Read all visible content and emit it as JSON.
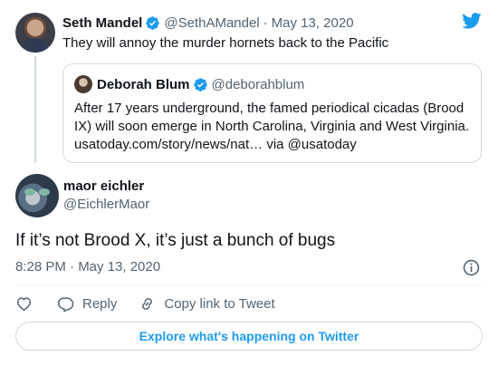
{
  "parent_tweet": {
    "author_name": "Seth Mandel",
    "handle": "@SethAMandel",
    "separator": "·",
    "date": "May 13, 2020",
    "text": "They will annoy the murder hornets back to the Pacific"
  },
  "quoted_tweet": {
    "author_name": "Deborah Blum",
    "handle": "@deborahblum",
    "text_lines": [
      "After 17 years underground, the famed periodical cicadas (Brood",
      "IX) will soon emerge in North Carolina, Virginia and West Virginia.",
      "usatoday.com/story/news/nat… via @usatoday"
    ]
  },
  "main_tweet": {
    "author_name": "maor eichler",
    "handle": "@EichlerMaor",
    "text": "If it’s not Brood X, it’s just a bunch of bugs",
    "timestamp": "8:28 PM · May 13, 2020"
  },
  "actions": {
    "reply_label": "Reply",
    "copy_label": "Copy link to Tweet"
  },
  "explore_label": "Explore what's happening on Twitter",
  "colors": {
    "twitter_blue": "#1d9bf0",
    "secondary_text": "#536471",
    "border": "#cfd9de"
  },
  "icons": [
    "verified-badge-icon",
    "twitter-bird-icon",
    "info-icon",
    "heart-icon",
    "reply-icon",
    "link-icon"
  ]
}
